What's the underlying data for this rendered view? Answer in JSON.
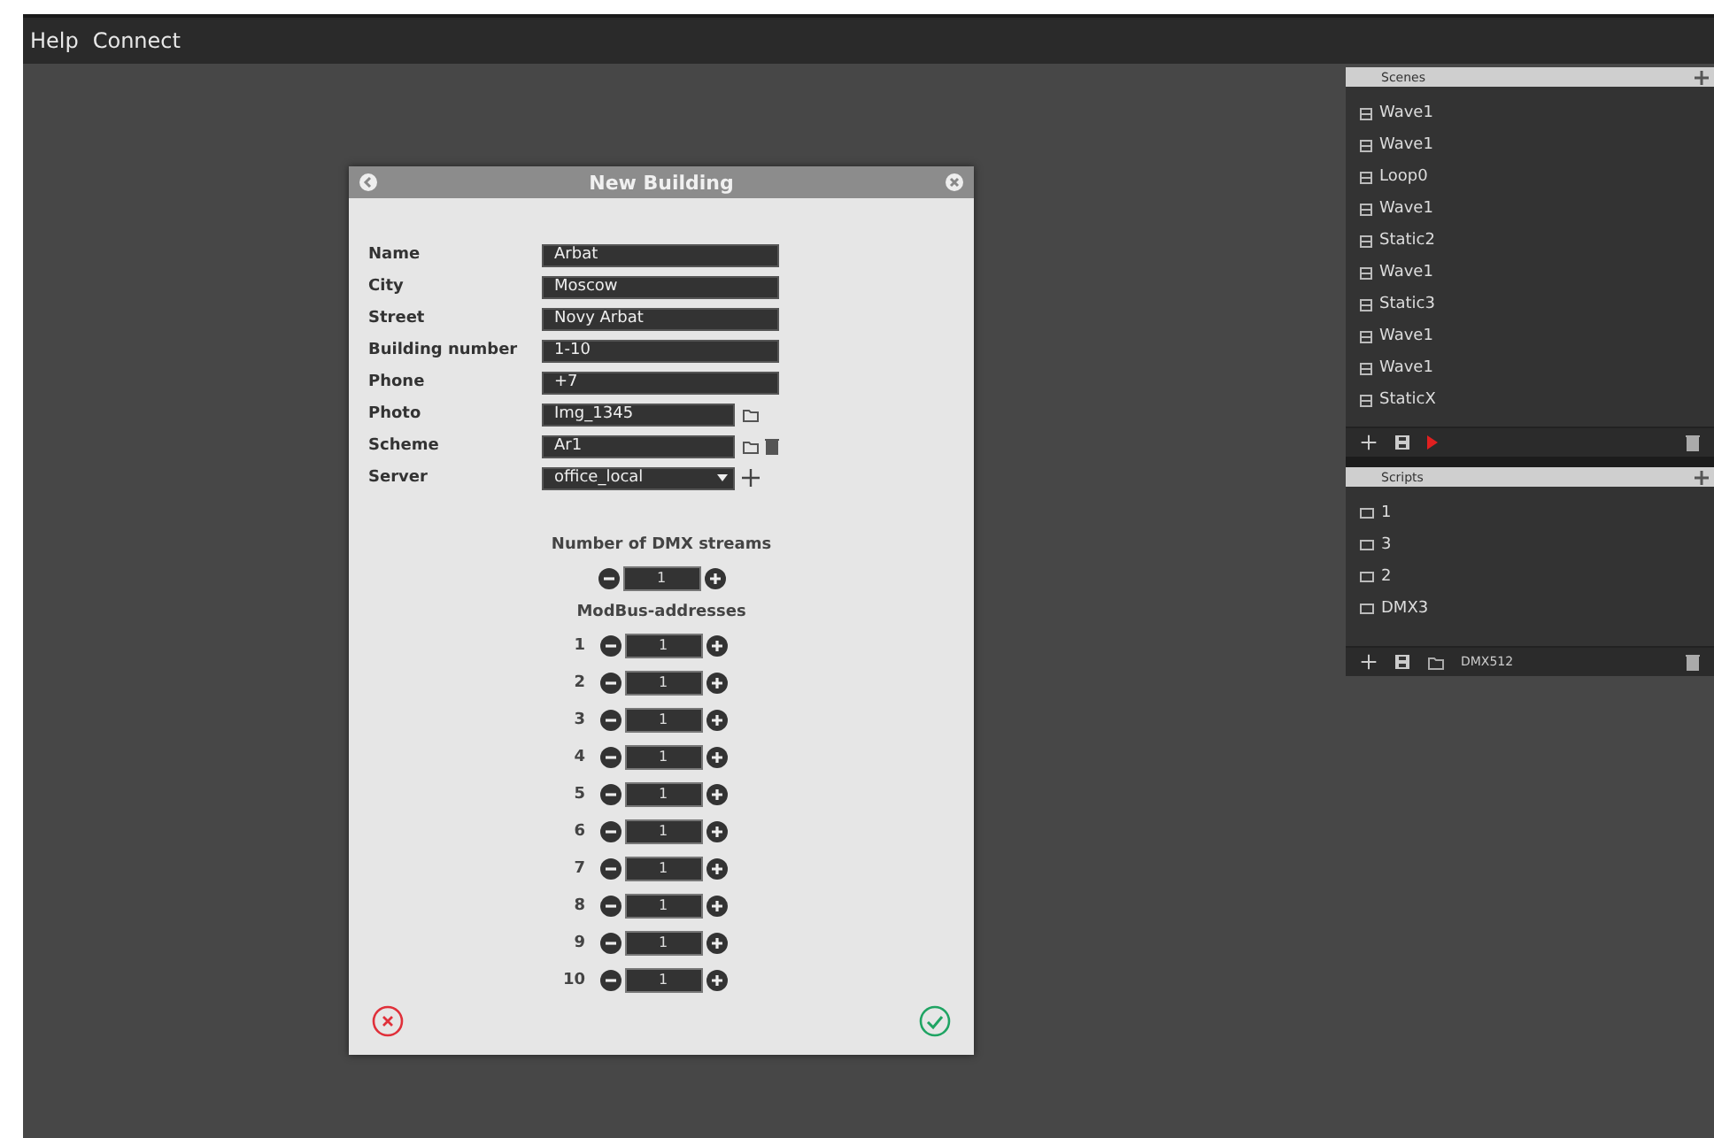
{
  "menu": [
    "Help",
    "Connect"
  ],
  "dialog": {
    "title": "New Building",
    "fields": [
      {
        "label": "Name",
        "value": "Arbat",
        "kind": "text"
      },
      {
        "label": "City",
        "value": "Moscow",
        "kind": "text"
      },
      {
        "label": "Street",
        "value": "Novy Arbat",
        "kind": "text"
      },
      {
        "label": "Building number",
        "value": "1-10",
        "kind": "text"
      },
      {
        "label": "Phone",
        "value": "+7",
        "kind": "text"
      },
      {
        "label": "Photo",
        "value": "Img_1345",
        "kind": "file"
      },
      {
        "label": "Scheme",
        "value": "Ar1",
        "kind": "file_delete"
      },
      {
        "label": "Server",
        "value": "office_local",
        "kind": "select"
      }
    ],
    "dmx": {
      "heading": "Number of DMX streams",
      "value": "1"
    },
    "modbus": {
      "heading": "ModBus-addresses",
      "rows": [
        {
          "label": "1",
          "value": "1"
        },
        {
          "label": "2",
          "value": "1"
        },
        {
          "label": "3",
          "value": "1"
        },
        {
          "label": "4",
          "value": "1"
        },
        {
          "label": "5",
          "value": "1"
        },
        {
          "label": "6",
          "value": "1"
        },
        {
          "label": "7",
          "value": "1"
        },
        {
          "label": "8",
          "value": "1"
        },
        {
          "label": "9",
          "value": "1"
        },
        {
          "label": "10",
          "value": "1"
        }
      ]
    }
  },
  "scenes": {
    "title": "Scenes",
    "items": [
      "Wave1",
      "Wave1",
      "Loop0",
      "Wave1",
      "Static2",
      "Wave1",
      "Static3",
      "Wave1",
      "Wave1",
      "StaticX"
    ]
  },
  "scripts": {
    "title": "Scripts",
    "items": [
      "1",
      "3",
      "2",
      "DMX3"
    ],
    "footer_label": "DMX512"
  }
}
